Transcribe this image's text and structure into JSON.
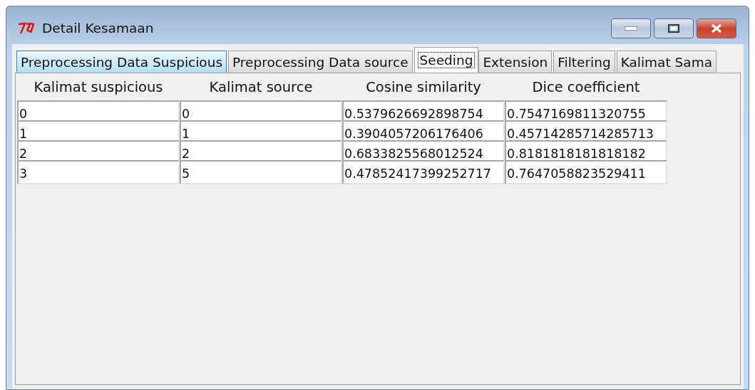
{
  "window": {
    "title": "Detail Kesamaan"
  },
  "tabs": [
    {
      "label": "Preprocessing Data Suspicious",
      "selected": false,
      "hovered": true
    },
    {
      "label": "Preprocessing Data source",
      "selected": false,
      "hovered": false
    },
    {
      "label": "Seeding",
      "selected": true,
      "hovered": false
    },
    {
      "label": "Extension",
      "selected": false,
      "hovered": false
    },
    {
      "label": "Filtering",
      "selected": false,
      "hovered": false
    },
    {
      "label": "Kalimat Sama",
      "selected": false,
      "hovered": false
    }
  ],
  "table": {
    "columns": [
      "Kalimat suspicious",
      "Kalimat source",
      "Cosine similarity",
      "Dice coefficient"
    ],
    "rows": [
      [
        "0",
        "0",
        "0.5379626692898754",
        "0.7547169811320755"
      ],
      [
        "1",
        "1",
        "0.3904057206176406",
        "0.45714285714285713"
      ],
      [
        "2",
        "2",
        "0.6833825568012524",
        "0.8181818181818182"
      ],
      [
        "3",
        "5",
        "0.47852417399252717",
        "0.7647058823529411"
      ]
    ]
  }
}
